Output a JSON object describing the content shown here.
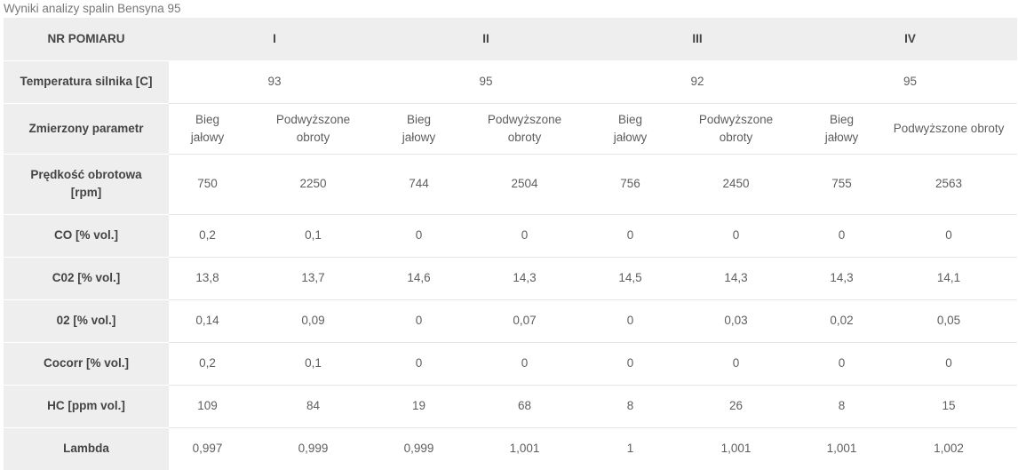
{
  "caption": "Wyniki analizy spalin Bensyna 95",
  "header": {
    "label": "NR POMIARU",
    "measurements": [
      "I",
      "II",
      "III",
      "IV"
    ]
  },
  "temperature": {
    "label": "Temperatura silnika [C]",
    "values": [
      "93",
      "95",
      "92",
      "95"
    ]
  },
  "parameter": {
    "label": "Zmierzony parametr",
    "modes": [
      [
        "Bieg",
        "jałowy"
      ],
      [
        "Podwyższone",
        "obroty"
      ],
      [
        "Bieg",
        "jałowy"
      ],
      [
        "Podwyższone",
        "obroty"
      ],
      [
        "Bieg",
        "jałowy"
      ],
      [
        "Podwyższone",
        "obroty"
      ],
      [
        "Bieg",
        "jałowy"
      ],
      [
        "Podwyższone obroty"
      ]
    ]
  },
  "rpm": {
    "label": [
      "Prędkość obrotowa",
      "[rpm]"
    ],
    "values": [
      "750",
      "2250",
      "744",
      "2504",
      "756",
      "2450",
      "755",
      "2563"
    ]
  },
  "rows": [
    {
      "label": "CO [% vol.]",
      "values": [
        "0,2",
        "0,1",
        "0",
        "0",
        "0",
        "0",
        "0",
        "0"
      ]
    },
    {
      "label": "C02 [% vol.]",
      "values": [
        "13,8",
        "13,7",
        "14,6",
        "14,3",
        "14,5",
        "14,3",
        "14,3",
        "14,1"
      ]
    },
    {
      "label": "02 [% vol.]",
      "values": [
        "0,14",
        "0,09",
        "0",
        "0,07",
        "0",
        "0,03",
        "0,02",
        "0,05"
      ]
    },
    {
      "label": "Cocorr [% vol.]",
      "values": [
        "0,2",
        "0,1",
        "0",
        "0",
        "0",
        "0",
        "0",
        "0"
      ]
    },
    {
      "label": "HC [ppm vol.]",
      "values": [
        "109",
        "84",
        "19",
        "68",
        "8",
        "26",
        "8",
        "15"
      ]
    },
    {
      "label": "Lambda",
      "values": [
        "0,997",
        "0,999",
        "0,999",
        "1,001",
        "1",
        "1,001",
        "1,001",
        "1,002"
      ]
    }
  ]
}
